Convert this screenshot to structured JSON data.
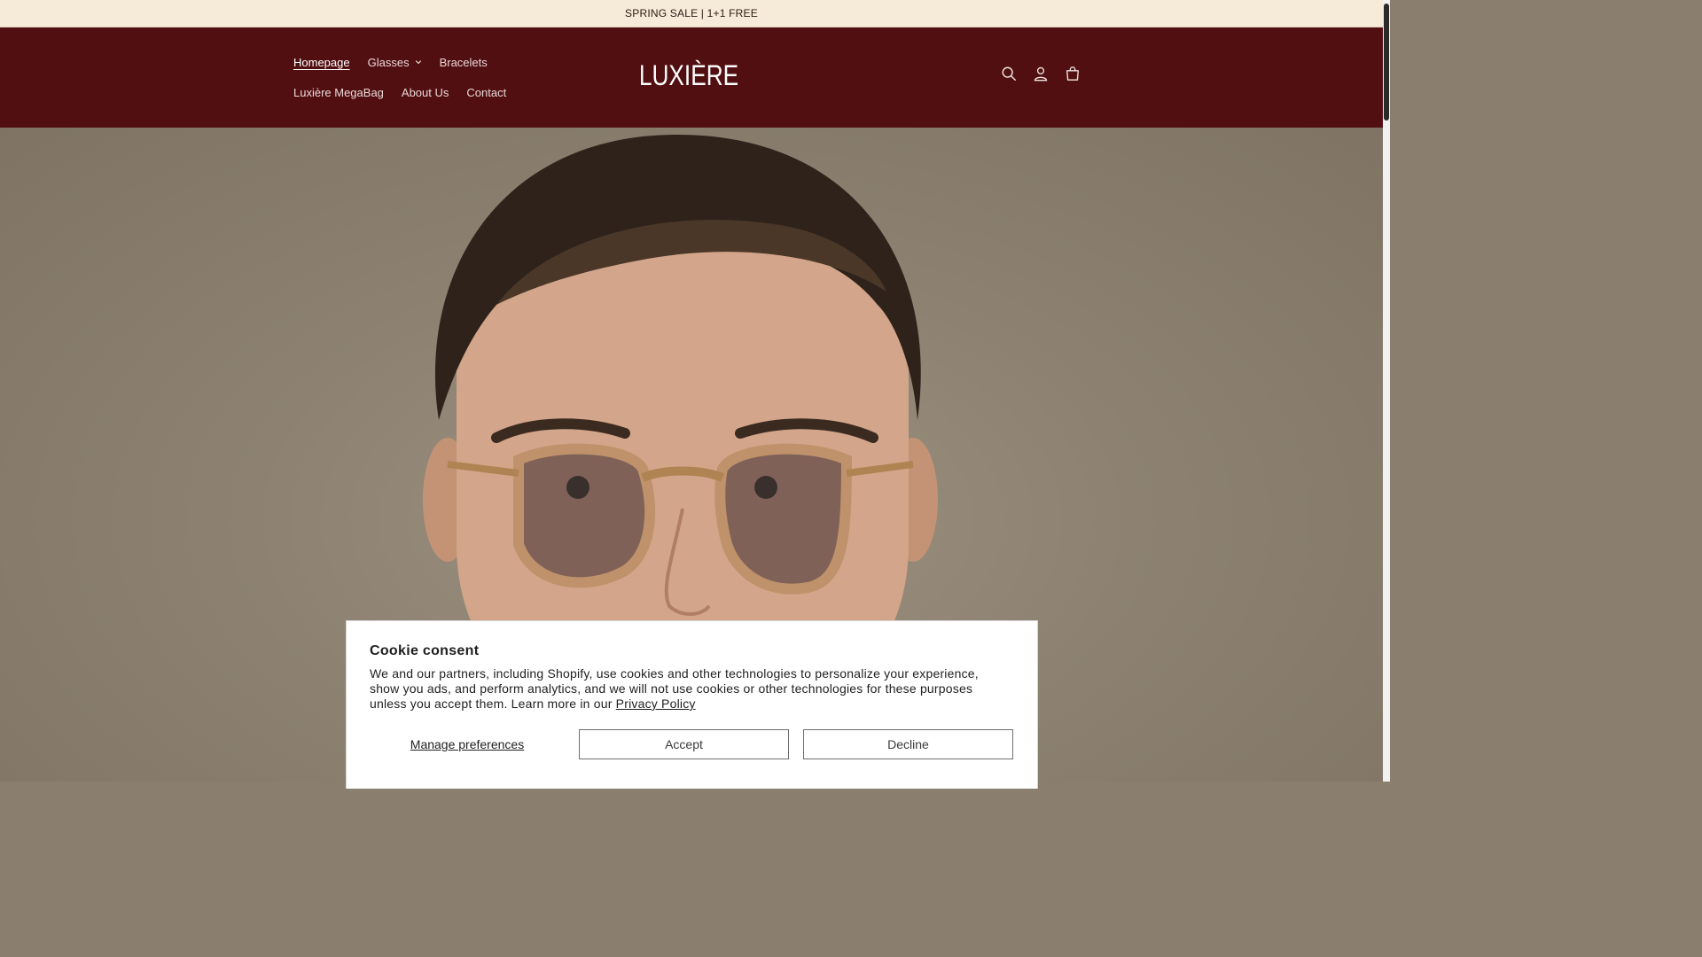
{
  "announcement": {
    "text": "SPRING SALE | 1+1 FREE"
  },
  "header": {
    "brand": "LUXIÈRE",
    "nav_row1": [
      {
        "label": "Homepage",
        "active": true
      },
      {
        "label": "Glasses",
        "has_dropdown": true
      },
      {
        "label": "Bracelets"
      }
    ],
    "nav_row2": [
      {
        "label": "Luxière MegaBag"
      },
      {
        "label": "About Us"
      },
      {
        "label": "Contact"
      }
    ],
    "icons": [
      "search-icon",
      "account-icon",
      "cart-icon"
    ]
  },
  "cookie": {
    "title": "Cookie consent",
    "body": "We and our partners, including Shopify, use cookies and other technologies to personalize your experience, show you ads, and perform analytics, and we will not use cookies or other technologies for these purposes unless you accept them. Learn more in our",
    "link": "Privacy Policy",
    "manage_label": "Manage preferences",
    "accept_label": "Accept",
    "decline_label": "Decline"
  },
  "colors": {
    "header_bg": "#520f12",
    "announcement_bg": "#f6ead8"
  }
}
